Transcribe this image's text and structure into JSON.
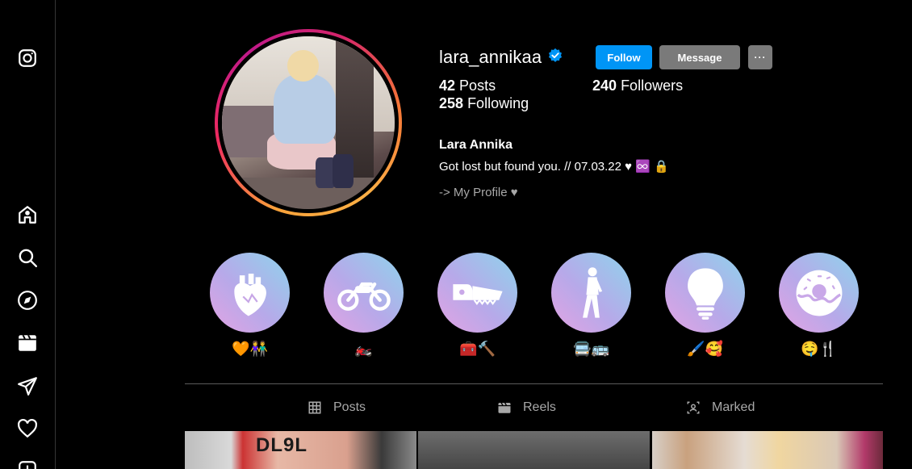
{
  "profile": {
    "username": "lara_annikaa",
    "full_name": "Lara Annika",
    "bio": "Got lost but found you. // 07.03.22 ♥ ♾️ 🔒",
    "link_text": "-> My Profile ♥",
    "verified": true
  },
  "actions": {
    "follow": "Follow",
    "message": "Message",
    "more": "···"
  },
  "stats": {
    "posts_count": "42",
    "posts_label": "Posts",
    "followers_count": "240",
    "followers_label": "Followers",
    "following_count": "258",
    "following_label": "Following"
  },
  "highlights": [
    {
      "icon": "heart-organ-icon",
      "label": "🧡👫"
    },
    {
      "icon": "motorcycle-icon",
      "label": "🏍️"
    },
    {
      "icon": "saw-icon",
      "label": "🧰🔨"
    },
    {
      "icon": "walking-woman-icon",
      "label": "🚍🚌"
    },
    {
      "icon": "lightbulb-icon",
      "label": "🖌️🥰"
    },
    {
      "icon": "donut-icon",
      "label": "🤤🍴"
    }
  ],
  "tabs": [
    {
      "label": "Posts",
      "icon": "grid-icon"
    },
    {
      "label": "Reels",
      "icon": "clapperboard-icon"
    },
    {
      "label": "Marked",
      "icon": "tagged-people-icon"
    }
  ],
  "grid": {
    "first_post_text": "DL9L"
  },
  "sidebar": [
    {
      "icon": "instagram-logo-icon"
    },
    {
      "icon": "home-icon"
    },
    {
      "icon": "search-icon"
    },
    {
      "icon": "explore-compass-icon"
    },
    {
      "icon": "reels-icon"
    },
    {
      "icon": "direct-messages-icon"
    },
    {
      "icon": "notifications-heart-icon"
    },
    {
      "icon": "create-post-icon"
    }
  ],
  "colors": {
    "background": "#000000",
    "follow_button": "#0095f6",
    "secondary_button": "#7a7a7a",
    "verified_badge": "#0095f6",
    "muted_text": "#a8a8a8"
  }
}
